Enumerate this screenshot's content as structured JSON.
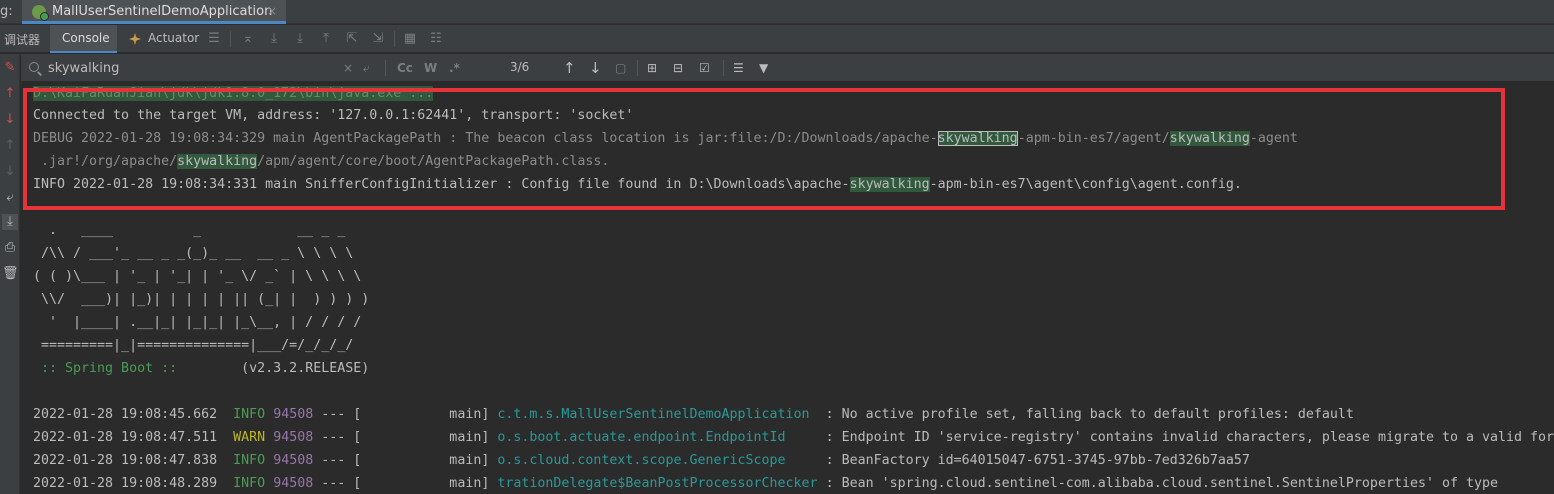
{
  "tab": {
    "prefix": "g:",
    "title": "MallUserSentinelDemoApplication",
    "close": "×"
  },
  "toolbar": {
    "debugger_label": "调试器",
    "console_label": "Console",
    "actuator_label": "Actuator"
  },
  "search": {
    "value": "skywalking",
    "placeholder": "",
    "clear": "×",
    "newline": "⤶",
    "match_case": "Cc",
    "words": "W",
    "regex": ".*",
    "match_count": "3/6"
  },
  "console": {
    "cmd": "D:\\KaiFaRuanJian\\jdk\\jdk1.8.0_172\\bin\\java.exe ...",
    "connected": "Connected to the target VM, address: '127.0.0.1:62441', transport: 'socket'",
    "debug_line": {
      "p1": "DEBUG 2022-01-28 19:08:34:329 main AgentPackagePath : The beacon class location is jar:file:/D:/Downloads/apache-",
      "m1": "skywalking",
      "p2": "-apm-bin-es7/agent/",
      "m2": "skywalking",
      "p3": "-agent"
    },
    "debug_cont": {
      "p1": " .jar!/org/apache/",
      "m1": "skywalking",
      "p2": "/apm/agent/core/boot/AgentPackagePath.class."
    },
    "info_line": {
      "p1": "INFO 2022-01-28 19:08:34:331 main SnifferConfigInitializer : Config file found in D:\\Downloads\\apache-",
      "m1": "skywalking",
      "p2": "-apm-bin-es7\\agent\\config\\agent.config."
    },
    "banner": [
      "  .   ____          _            __ _ _",
      " /\\\\ / ___'_ __ _ _(_)_ __  __ _ \\ \\ \\ \\",
      "( ( )\\___ | '_ | '_| | '_ \\/ _` | \\ \\ \\ \\",
      " \\\\/  ___)| |_)| | | | | || (_| |  ) ) ) )",
      "  '  |____| .__|_| |_|_| |_\\__, | / / / /",
      " =========|_|==============|___/=/_/_/_/"
    ],
    "spring_label": " :: Spring Boot ::",
    "spring_version": "        (v2.3.2.RELEASE)",
    "logs": [
      {
        "ts": "2022-01-28 19:08:45.662",
        "level": "INFO",
        "pid": "94508",
        "sep": " --- [           main] ",
        "logger": "c.t.m.s.MallUserSentinelDemoApplication ",
        "msg": " : No active profile set, falling back to default profiles: default"
      },
      {
        "ts": "2022-01-28 19:08:47.511",
        "level": "WARN",
        "pid": "94508",
        "sep": " --- [           main] ",
        "logger": "o.s.boot.actuate.endpoint.EndpointId    ",
        "msg": " : Endpoint ID 'service-registry' contains invalid characters, please migrate to a valid format."
      },
      {
        "ts": "2022-01-28 19:08:47.838",
        "level": "INFO",
        "pid": "94508",
        "sep": " --- [           main] ",
        "logger": "o.s.cloud.context.scope.GenericScope    ",
        "msg": " : BeanFactory id=64015047-6751-3745-97bb-7ed326b7aa57"
      },
      {
        "ts": "2022-01-28 19:08:48.289",
        "level": "INFO",
        "pid": "94508",
        "sep": " --- [           main] ",
        "logger": "trationDelegate$BeanPostProcessorChecker",
        "msg": " : Bean 'spring.cloud.sentinel-com.alibaba.cloud.sentinel.SentinelProperties' of type"
      }
    ]
  },
  "colors": {
    "highlight_box": "#e5333a",
    "match_bg": "#32593d",
    "info": "#499c54",
    "warn": "#bbb529",
    "pid": "#9876aa",
    "logger": "#299999"
  }
}
